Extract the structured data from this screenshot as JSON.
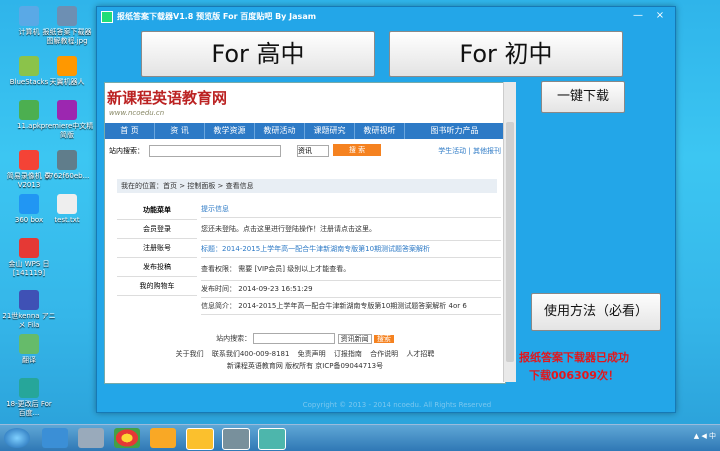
{
  "desktop": {
    "icons": [
      {
        "label": "计算机",
        "color": "#5aa9e6"
      },
      {
        "label": "报纸答案下载器\n图解教程.jpg",
        "color": "#6d8fb3"
      },
      {
        "label": "BlueStacks",
        "color": "#8bc34a"
      },
      {
        "label": "天翼机器人",
        "color": "#ff9800"
      },
      {
        "label": "11.apk",
        "color": "#4caf50"
      },
      {
        "label": "premiere中文精简版",
        "color": "#9c27b0"
      },
      {
        "label": "简易录像机\n录V2013",
        "color": "#f44336"
      },
      {
        "label": "6762f60eb...",
        "color": "#607d8b"
      },
      {
        "label": "360 box",
        "color": "#2196f3"
      },
      {
        "label": "test.txt",
        "color": "#eeeeee"
      },
      {
        "label": "金山 WPS 日\n[141119]",
        "color": "#e53935"
      },
      {
        "label": "21世kenna\nアニメ Fila",
        "color": "#3f51b5"
      },
      {
        "label": "翻译",
        "color": "#66bb6a"
      },
      {
        "label": "18-更改后\nFor 百度...",
        "color": "#26a69a"
      }
    ]
  },
  "window": {
    "title": "报纸答案下载器V1.8 预览版 For 百度贴吧 By Jasam",
    "controls": {
      "min": "—",
      "close": "×"
    },
    "btn_high": "For 高中",
    "btn_mid": "For 初中",
    "btn_download": "一键下载",
    "btn_usage": "使用方法（必看）",
    "status": "报纸答案下载器已成功下载006309次！",
    "bottom_faded": "Copyright © 2013 - 2014 ncoedu. All Rights Reserved"
  },
  "web": {
    "logo": "新课程英语教育网",
    "url": "www.ncoedu.cn",
    "nav": [
      "首 页",
      "资 讯",
      "教学资源",
      "教研活动",
      "课题研究",
      "教研视听",
      "图书听力产品"
    ],
    "search_label": "站内搜索：",
    "search_select": "资讯",
    "search_button": "搜 索",
    "links_right": "学生活动 | 其他报刊",
    "breadcrumb": "我在的位置：首页 > 控制面板 > 查看信息",
    "menu_title": "功能菜单",
    "menu": [
      "会员登录",
      "注册账号",
      "发布投稿",
      "我的购物车"
    ],
    "info_title": "提示信息",
    "info_login": "您还未登陆。点击这里进行登陆操作！注册请点击这里。",
    "article_title": "标题：2014-2015上学年高一配合牛津新湖南专版第10期测试题答案解析",
    "permission_label": "查看权限：",
    "permission_value": "需要 [VIP会员] 级别以上才能查看。",
    "time_label": "发布时间：",
    "time_value": "2014-09-23 16:51:29",
    "summary_label": "信息简介：",
    "summary_value": "2014-2015上学年高一配合牛津新湖南专版第10期测试题答案解析 4or 6",
    "footer_search_label": "站内搜索：",
    "footer_select": "资讯新闻",
    "footer_button": "搜索",
    "footer_links": [
      "关于我们",
      "联系我们400-009-8181",
      "免责声明",
      "订报指南",
      "合作说明",
      "人才招聘"
    ],
    "footer_copy": "新课程英语教育网 版权所有 京ICP备09044713号"
  },
  "taskbar": {
    "apps": [
      "start",
      "explorer",
      "magnifier",
      "chrome",
      "tiles",
      "folder",
      "app1",
      "app2"
    ],
    "tray": "▲ ◀ 中"
  }
}
